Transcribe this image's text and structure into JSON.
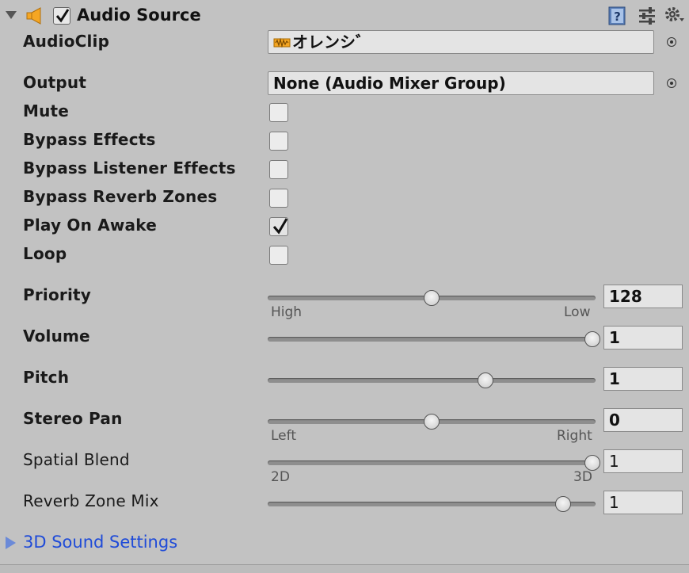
{
  "component": {
    "title": "Audio Source",
    "enabled": true
  },
  "fields": {
    "audio_clip": {
      "label": "AudioClip",
      "value": "オレンシ゛"
    },
    "output": {
      "label": "Output",
      "value": "None (Audio Mixer Group)"
    },
    "mute": {
      "label": "Mute",
      "checked": false
    },
    "bypass_effects": {
      "label": "Bypass Effects",
      "checked": false
    },
    "bypass_listener_effects": {
      "label": "Bypass Listener Effects",
      "checked": false
    },
    "bypass_reverb_zones": {
      "label": "Bypass Reverb Zones",
      "checked": false
    },
    "play_on_awake": {
      "label": "Play On Awake",
      "checked": true
    },
    "loop": {
      "label": "Loop",
      "checked": false
    }
  },
  "sliders": {
    "priority": {
      "label": "Priority",
      "value": "128",
      "min_label": "High",
      "max_label": "Low",
      "fraction": 0.5
    },
    "volume": {
      "label": "Volume",
      "value": "1",
      "fraction": 1.0
    },
    "pitch": {
      "label": "Pitch",
      "value": "1",
      "fraction": 0.667
    },
    "stereo_pan": {
      "label": "Stereo Pan",
      "value": "0",
      "min_label": "Left",
      "max_label": "Right",
      "fraction": 0.5
    },
    "spatial_blend": {
      "label": "Spatial Blend",
      "value": "1",
      "min_label": "2D",
      "max_label": "3D",
      "fraction": 1.0
    },
    "reverb_zone_mix": {
      "label": "Reverb Zone Mix",
      "value": "1",
      "fraction": 0.909
    }
  },
  "foldout": {
    "label": "3D Sound Settings"
  },
  "colors": {
    "panel_bg": "#c2c2c2",
    "link_blue": "#1f4bd8",
    "speaker_orange": "#f5a623"
  }
}
